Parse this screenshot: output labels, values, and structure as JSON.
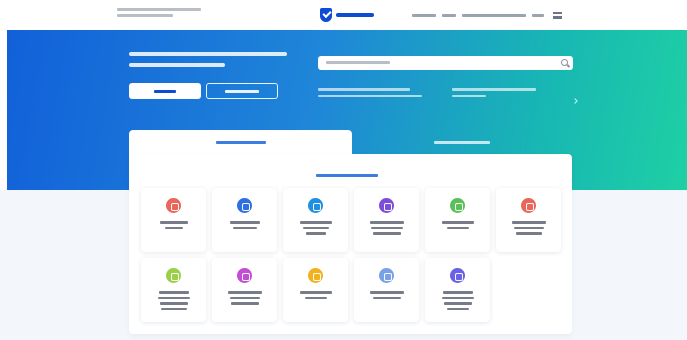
{
  "header": {
    "site_tagline": "",
    "logo_text": "",
    "nav": [
      "",
      "",
      "",
      ""
    ],
    "menu_icon": "hamburger-icon"
  },
  "hero": {
    "title": "",
    "primary_button": "",
    "secondary_button": "",
    "search": {
      "placeholder": ""
    },
    "hints": [
      "",
      ""
    ]
  },
  "tabs": [
    {
      "label": "",
      "active": true
    },
    {
      "label": "",
      "active": false
    }
  ],
  "panel": {
    "title": "",
    "cards": [
      {
        "label": "",
        "icon": "document-icon",
        "color": "#e8665a"
      },
      {
        "label": "",
        "icon": "person-icon",
        "color": "#2f6fe0"
      },
      {
        "label": "",
        "icon": "car-icon",
        "color": "#1f8fe0"
      },
      {
        "label": "",
        "icon": "shield-icon",
        "color": "#7c4fd9"
      },
      {
        "label": "",
        "icon": "house-icon",
        "color": "#5bbf5a"
      },
      {
        "label": "",
        "icon": "certificate-icon",
        "color": "#e8665a"
      },
      {
        "label": "",
        "icon": "family-icon",
        "color": "#9bcf4a"
      },
      {
        "label": "",
        "icon": "court-icon",
        "color": "#c24fd3"
      },
      {
        "label": "",
        "icon": "wallet-icon",
        "color": "#f2b21f"
      },
      {
        "label": "",
        "icon": "car-icon",
        "color": "#7aa1e6"
      },
      {
        "label": "",
        "icon": "child-icon",
        "color": "#6a62e6"
      }
    ]
  },
  "colors": {
    "brand": "#0d4cd3",
    "hero_start": "#1260d9",
    "hero_end": "#1ed0a4"
  }
}
